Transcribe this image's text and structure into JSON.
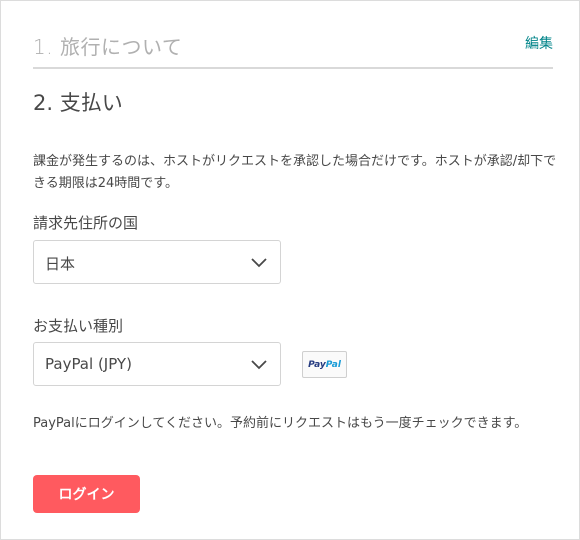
{
  "step1": {
    "title": "1. 旅行について",
    "edit_label": "編集"
  },
  "step2": {
    "title": "2. 支払い"
  },
  "notice": "課金が発生するのは、ホストがリクエストを承認した場合だけです。ホストが承認/却下できる期限は24時間です。",
  "billing_country": {
    "label": "請求先住所の国",
    "value": "日本"
  },
  "payment_type": {
    "label": "お支払い種別",
    "value": "PayPal (JPY)"
  },
  "paypal_logo": {
    "pay": "Pay",
    "pal": "Pal"
  },
  "paypal_note": "PayPalにログインしてください。予約前にリクエストはもう一度チェックできます。",
  "login_button": "ログイン",
  "colors": {
    "accent_teal": "#008489",
    "button_coral": "#ff5a5f"
  }
}
